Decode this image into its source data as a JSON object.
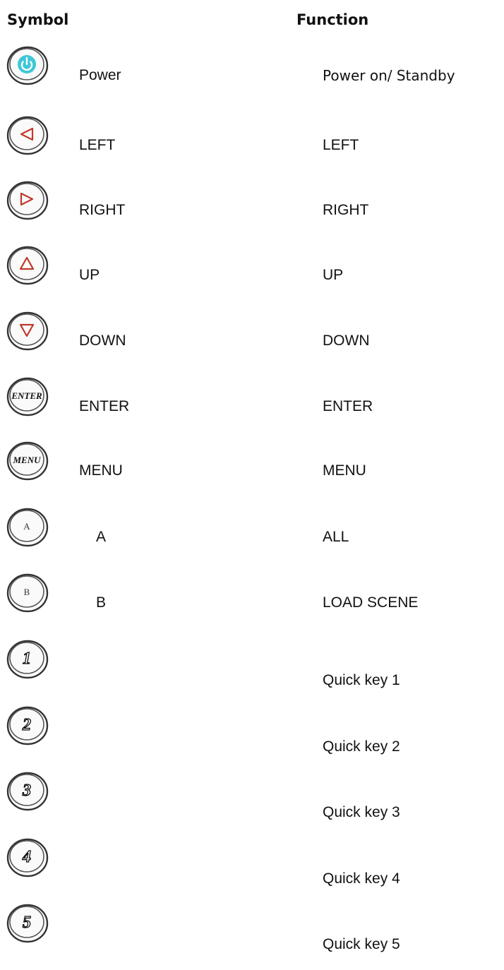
{
  "headers": {
    "symbol": "Symbol",
    "function": "Function"
  },
  "rows": [
    {
      "icon": "power-icon",
      "label": "Power",
      "function": "Power on/ Standby"
    },
    {
      "icon": "left-arrow-icon",
      "label": "LEFT",
      "function": "LEFT"
    },
    {
      "icon": "right-arrow-icon",
      "label": "RIGHT",
      "function": "RIGHT"
    },
    {
      "icon": "up-arrow-icon",
      "label": "UP",
      "function": "UP"
    },
    {
      "icon": "down-arrow-icon",
      "label": "DOWN",
      "function": "DOWN"
    },
    {
      "icon": "enter-icon",
      "icon_text": "ENTER",
      "label": "ENTER",
      "function": "ENTER"
    },
    {
      "icon": "menu-icon",
      "icon_text": "MENU",
      "label": "MENU",
      "function": "MENU"
    },
    {
      "icon": "a-icon",
      "icon_text": "A",
      "label": "A",
      "function": "ALL"
    },
    {
      "icon": "b-icon",
      "icon_text": "B",
      "label": "B",
      "function": "LOAD SCENE"
    },
    {
      "icon": "key-1-icon",
      "icon_text": "1",
      "label": "",
      "function": "Quick key 1"
    },
    {
      "icon": "key-2-icon",
      "icon_text": "2",
      "label": "",
      "function": "Quick key 2"
    },
    {
      "icon": "key-3-icon",
      "icon_text": "3",
      "label": "",
      "function": "Quick key 3"
    },
    {
      "icon": "key-4-icon",
      "icon_text": "4",
      "label": "",
      "function": "Quick key 4"
    },
    {
      "icon": "key-5-icon",
      "icon_text": "5",
      "label": "",
      "function": "Quick key 5"
    }
  ],
  "colors": {
    "power": "#3ec8d6",
    "arrows": "#c0392b",
    "ring": "#333333"
  }
}
